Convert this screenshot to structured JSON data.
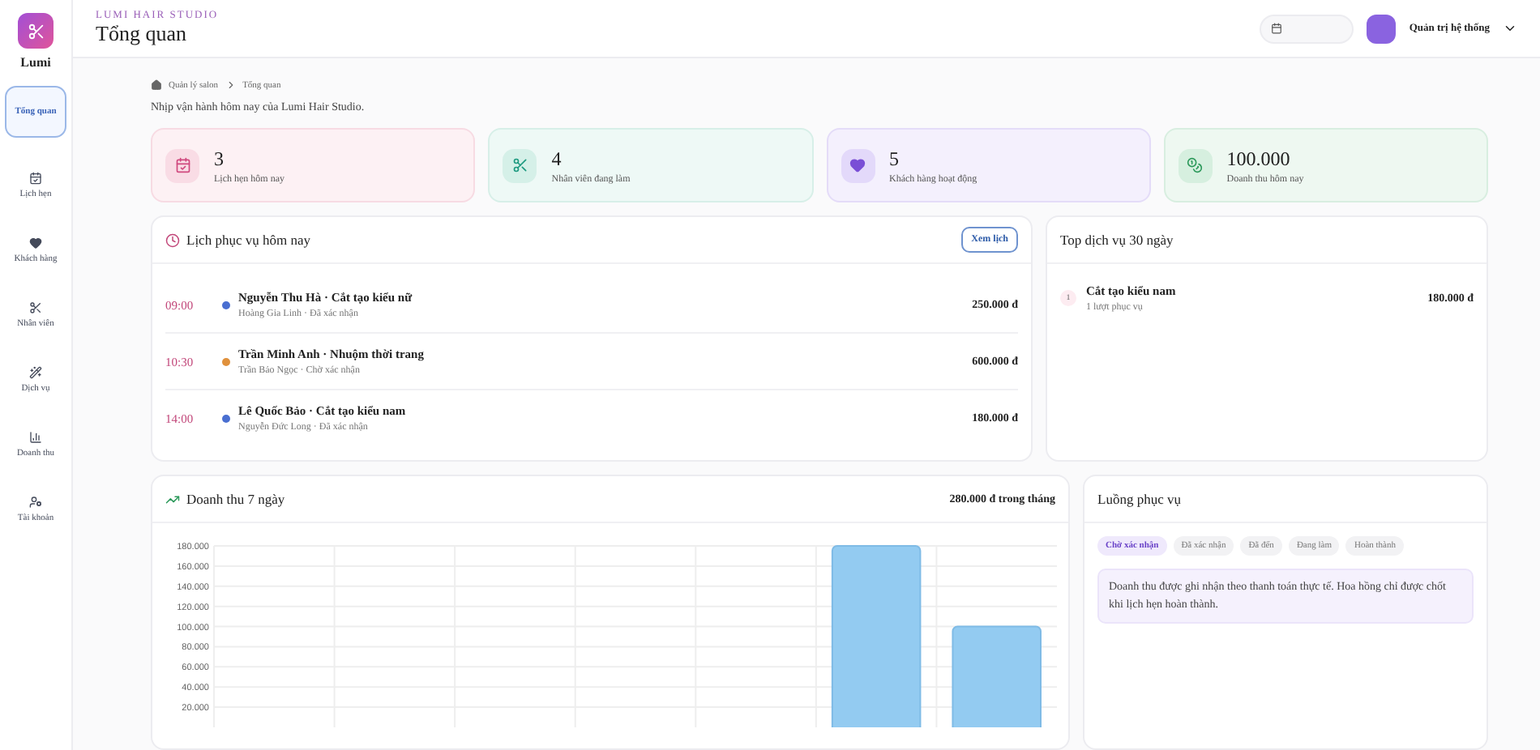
{
  "sidebar": {
    "brand": "Lumi",
    "items": [
      {
        "label": "Tổng quan",
        "selected": true
      },
      {
        "label": "Lịch hẹn",
        "selected": false
      },
      {
        "label": "Khách hàng",
        "selected": false
      },
      {
        "label": "Nhân viên",
        "selected": false
      },
      {
        "label": "Dịch vụ",
        "selected": false
      },
      {
        "label": "Doanh thu",
        "selected": false
      },
      {
        "label": "Tài khoản",
        "selected": false
      }
    ]
  },
  "header": {
    "eyebrow": "LUMI HAIR STUDIO",
    "title": "Tổng quan",
    "user": "Quản trị hệ thống"
  },
  "breadcrumb": [
    "Quản lý salon",
    "Tổng quan"
  ],
  "subtitle": "Nhịp vận hành hôm nay của Lumi Hair Studio.",
  "stats": [
    {
      "value": "3",
      "label": "Lịch hẹn hôm nay"
    },
    {
      "value": "4",
      "label": "Nhân viên đang làm"
    },
    {
      "value": "5",
      "label": "Khách hàng hoạt động"
    },
    {
      "value": "100.000",
      "label": "Doanh thu hôm nay"
    }
  ],
  "schedule": {
    "title": "Lịch phục vụ hôm nay",
    "action": "Xem lịch",
    "rows": [
      {
        "time": "09:00",
        "color": "#4a6fd1",
        "title": "Nguyễn Thu Hà · Cắt tạo kiểu nữ",
        "meta": "Hoàng Gia Linh · Đã xác nhận",
        "price": "250.000 đ"
      },
      {
        "time": "10:30",
        "color": "#e0913c",
        "title": "Trần Minh Anh · Nhuộm thời trang",
        "meta": "Trần Bảo Ngọc · Chờ xác nhận",
        "price": "600.000 đ"
      },
      {
        "time": "14:00",
        "color": "#4a6fd1",
        "title": "Lê Quốc Bảo · Cắt tạo kiểu nam",
        "meta": "Nguyễn Đức Long · Đã xác nhận",
        "price": "180.000 đ"
      }
    ]
  },
  "top_services": {
    "title": "Top dịch vụ 30 ngày",
    "rows": [
      {
        "rank": "1",
        "name": "Cắt tạo kiểu nam",
        "meta": "1 lượt phục vụ",
        "price": "180.000 đ"
      }
    ]
  },
  "revenue": {
    "title": "Doanh thu 7 ngày",
    "total": "280.000 đ trong tháng",
    "chart_data": {
      "type": "bar",
      "grid": true,
      "values": [
        0,
        0,
        0,
        0,
        0,
        180000,
        100000
      ],
      "ylim": [
        0,
        180000
      ],
      "yticks": [
        {
          "value": 20000,
          "label": "20.000"
        },
        {
          "value": 40000,
          "label": "40.000"
        },
        {
          "value": 60000,
          "label": "60.000"
        },
        {
          "value": 80000,
          "label": "80.000"
        },
        {
          "value": 100000,
          "label": "100.000"
        },
        {
          "value": 120000,
          "label": "120.000"
        },
        {
          "value": 140000,
          "label": "140.000"
        },
        {
          "value": 160000,
          "label": "160.000"
        },
        {
          "value": 180000,
          "label": "180.000"
        }
      ]
    }
  },
  "flow": {
    "title": "Luồng phục vụ",
    "steps": [
      {
        "label": "Chờ xác nhận",
        "selected": true
      },
      {
        "label": "Đã xác nhận",
        "selected": false
      },
      {
        "label": "Đã đến",
        "selected": false
      },
      {
        "label": "Đang làm",
        "selected": false
      },
      {
        "label": "Hoàn thành",
        "selected": false
      }
    ],
    "note": "Doanh thu được ghi nhận theo thanh toán thực tế. Hoa hồng chỉ được chốt khi lịch hẹn hoàn thành."
  }
}
